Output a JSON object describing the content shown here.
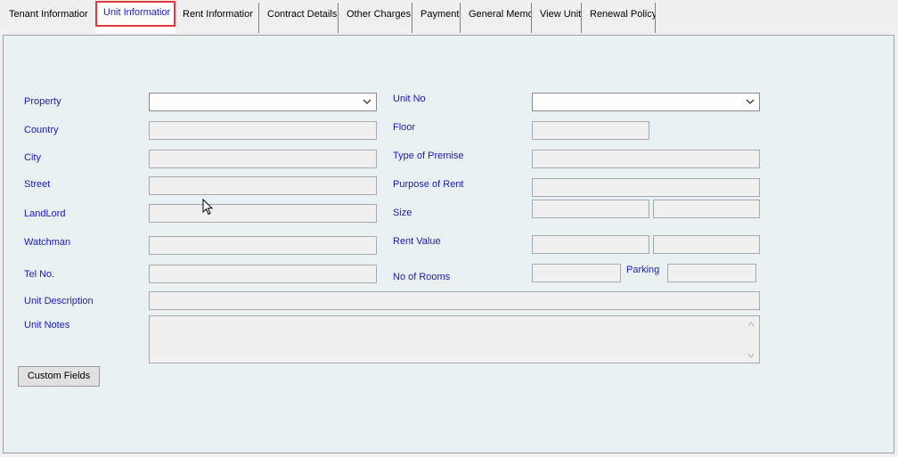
{
  "tabs": [
    {
      "label": "Tenant Informatior",
      "active": false
    },
    {
      "label": "Unit Informatior",
      "active": true
    },
    {
      "label": "Rent Informatior",
      "active": false
    },
    {
      "label": "Contract Details",
      "active": false
    },
    {
      "label": "Other Charges",
      "active": false
    },
    {
      "label": "Payment",
      "active": false
    },
    {
      "label": "General Memo",
      "active": false
    },
    {
      "label": "View Unit",
      "active": false
    },
    {
      "label": "Renewal Policy",
      "active": false
    }
  ],
  "form": {
    "property_label": "Property",
    "country_label": "Country",
    "city_label": "City",
    "street_label": "Street",
    "landlord_label": "LandLord",
    "watchman_label": "Watchman",
    "tel_label": "Tel No.",
    "unit_description_label": "Unit Description",
    "unit_notes_label": "Unit Notes",
    "unit_no_label": "Unit No",
    "floor_label": "Floor",
    "type_of_premise_label": "Type of Premise",
    "purpose_of_rent_label": "Purpose of Rent",
    "size_label": "Size",
    "rent_value_label": "Rent Value",
    "no_of_rooms_label": "No of Rooms",
    "parking_label": "Parking",
    "property_value": "",
    "unit_no_value": ""
  },
  "buttons": {
    "custom_fields": "Custom Fields"
  },
  "colors": {
    "label_text": "#1a1ab8",
    "panel_bg": "#e9f1f2",
    "active_tab_highlight": "#e03a3a"
  }
}
